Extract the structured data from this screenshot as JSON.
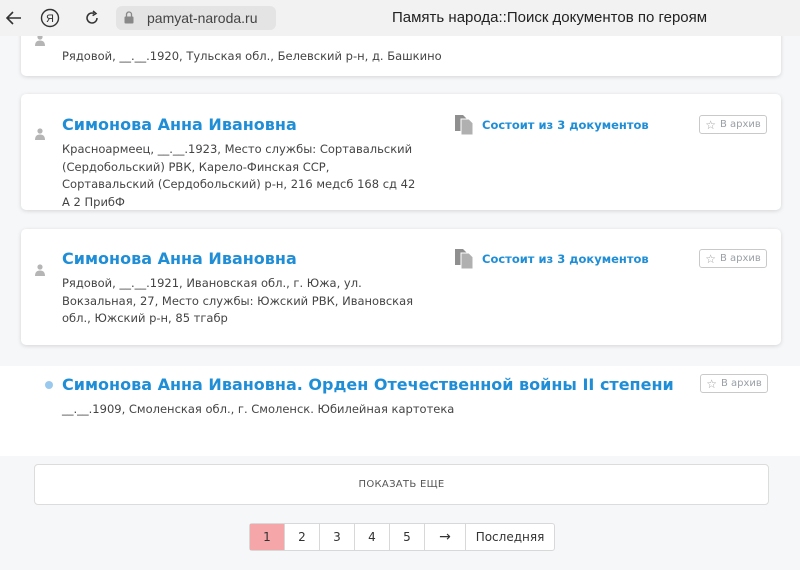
{
  "browser": {
    "url": "pamyat-naroda.ru",
    "tab_title": "Память народа::Поиск документов по героям",
    "yandex_label": "Я"
  },
  "records": [
    {
      "desc": "Рядовой, __.__.1920, Тульская обл., Белевский р-н, д. Башкино"
    },
    {
      "name": "Симонова Анна Ивановна",
      "desc": "Красноармеец, __.__.1923, Место службы: Сортавальский (Сердобольский) РВК, Карело-Финская ССР, Сортавальский (Сердобольский) р-н, 216 медсб 168 сд 42 А 2 ПрибФ",
      "docs": "Состоит из 3 документов",
      "archive": "В архив"
    },
    {
      "name": "Симонова Анна Ивановна",
      "desc": "Рядовой, __.__.1921, Ивановская обл., г. Южа, ул. Вокзальная, 27, Место службы: Южский РВК, Ивановская обл., Южский р-н, 85 тгабр",
      "docs": "Состоит из 3 документов",
      "archive": "В архив"
    },
    {
      "name": "Симонова Анна Ивановна. Орден Отечественной войны II степени",
      "desc": "__.__.1909, Смоленская обл., г. Смоленск. Юбилейная картотека",
      "archive": "В архив"
    }
  ],
  "show_more": "ПОКАЗАТЬ ЕЩЕ",
  "pagination": {
    "pages": [
      "1",
      "2",
      "3",
      "4",
      "5"
    ],
    "current": "1",
    "next": "→",
    "last": "Последняя"
  },
  "colors": {
    "link": "#1f8ed6",
    "active_page": "#f5a6a8"
  }
}
